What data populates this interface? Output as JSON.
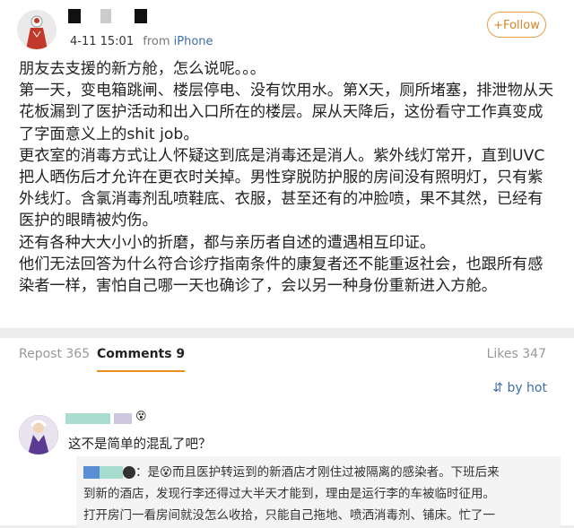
{
  "post": {
    "time": "4-11 15:01",
    "from_label": "from",
    "source": "iPhone",
    "follow_label": "+Follow",
    "paragraphs": [
      "朋友去支援的新方舱，怎么说呢。。。",
      "第一天，变电箱跳闸、楼层停电、没有饮用水。第X天，厕所堵塞，排泄物从天花板漏到了医护活动和出入口所在的楼层。屎从天降后，这份看守工作真变成了字面意义上的shit job。",
      "更衣室的消毒方式让人怀疑这到底是消毒还是消人。紫外线灯常开，直到UVC把人晒伤后才允许在更衣时关掉。男性穿脱防护服的房间没有照明灯，只有紫外线灯。含氯消毒剂乱喷鞋底、衣服，甚至还有的冲脸喷，果不其然，已经有医护的眼睛被灼伤。",
      "还有各种大大小小的折磨，都与亲历者自述的遭遇相互印证。",
      "他们无法回答为什么符合诊疗指南条件的康复者还不能重返社会，也跟所有感染者一样，害怕自己哪一天也确诊了，会以另一种身份重新进入方舱。"
    ]
  },
  "tabs": {
    "repost": "Repost 365",
    "comments": "Comments 9",
    "likes": "Likes 347"
  },
  "sort_label": "by hot",
  "comment": {
    "text": "这不是简单的混乱了吧？",
    "reply_line1": "：是😵而且医护转运到的新酒店才刚住过被隔离的感染者。下班后来",
    "reply_line2": "到新的酒店，发现行李还得过大半天才能到，理由是运行李的车被临时征用。",
    "reply_line3": "打开房门一看房间就没怎么收拾，只能自己拖地、喷洒消毒剂、铺床。忙了一"
  },
  "colors": {
    "accent": "#f08a24",
    "link": "#3d6fa8"
  }
}
